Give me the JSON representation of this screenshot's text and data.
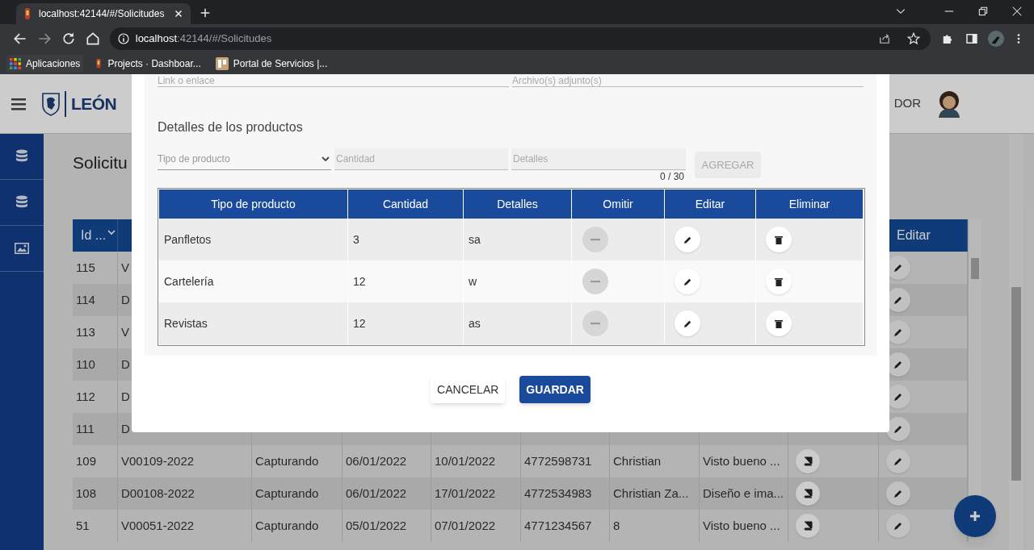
{
  "browser": {
    "tab_title": "localhost:42144/#/Solicitudes",
    "url_host": "localhost",
    "url_path": ":42144/#/Solicitudes",
    "bookmarks": [
      {
        "label": "Aplicaciones",
        "kind": "apps"
      },
      {
        "label": "Projects · Dashboar...",
        "kind": "site"
      },
      {
        "label": "Portal de Servicios |...",
        "kind": "portal"
      }
    ]
  },
  "header": {
    "logo_text": "LEÓN",
    "user_name": "DOR"
  },
  "sidebar": {
    "items": [
      {
        "kind": "database"
      },
      {
        "kind": "database"
      },
      {
        "kind": "image"
      }
    ]
  },
  "page": {
    "title": "Solicitu"
  },
  "table": {
    "columns": [
      "Id ...",
      "Editar"
    ],
    "rows": [
      {
        "cells": [
          "115",
          "V"
        ]
      },
      {
        "cells": [
          "114",
          "D"
        ]
      },
      {
        "cells": [
          "113",
          "V"
        ]
      },
      {
        "cells": [
          "110",
          "D"
        ]
      },
      {
        "cells": [
          "112",
          "D"
        ]
      },
      {
        "cells": [
          "111",
          "D"
        ]
      },
      {
        "cells": [
          "109",
          "V00109-2022",
          "Capturando",
          "06/01/2022",
          "10/01/2022",
          "4772598731",
          "Christian",
          "Visto bueno ..."
        ]
      },
      {
        "cells": [
          "108",
          "D00108-2022",
          "Capturando",
          "06/01/2022",
          "17/01/2022",
          "4772534983",
          "Christian Za...",
          "Diseño e ima..."
        ]
      },
      {
        "cells": [
          "51",
          "V00051-2022",
          "Capturando",
          "05/01/2022",
          "07/01/2022",
          "4771234567",
          "8",
          "Visto bueno ..."
        ]
      }
    ]
  },
  "modal": {
    "fields": [
      {
        "placeholder": "Link o enlace"
      },
      {
        "placeholder": "Archivo(s) adjunto(s)"
      }
    ],
    "section_title": "Detalles de los productos",
    "form": {
      "type_placeholder": "Tipo de producto",
      "quantity_placeholder": "Cantidad",
      "details_placeholder": "Detalles",
      "counter": "0 / 30",
      "add_button": {
        "label": "AGREGAR",
        "disabled": true
      }
    },
    "products": {
      "columns": [
        "Tipo de producto",
        "Cantidad",
        "Detalles",
        "Omitir",
        "Editar",
        "Eliminar"
      ],
      "rows": [
        {
          "cells": [
            "Panfletos",
            "3",
            "sa"
          ],
          "omit_disabled": true
        },
        {
          "cells": [
            "Cartelería",
            "12",
            "w"
          ],
          "omit_disabled": true
        },
        {
          "cells": [
            "Revistas",
            "12",
            "as"
          ],
          "omit_disabled": true
        }
      ]
    },
    "buttons": [
      {
        "label": "CANCELAR",
        "kind": "secondary"
      },
      {
        "label": "GUARDAR",
        "kind": "primary"
      }
    ]
  }
}
